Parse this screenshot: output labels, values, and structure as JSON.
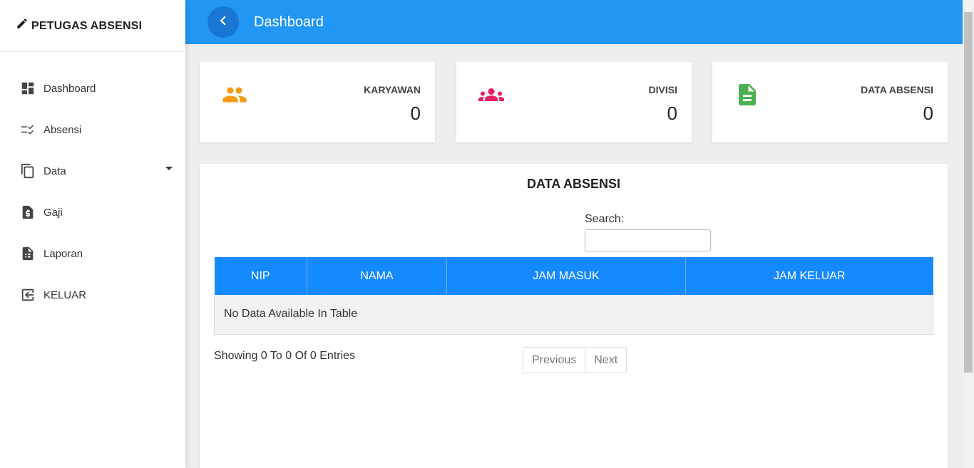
{
  "brand": {
    "title": "PETUGAS ABSENSI"
  },
  "sidebar": {
    "items": [
      {
        "label": "Dashboard"
      },
      {
        "label": "Absensi"
      },
      {
        "label": "Data"
      },
      {
        "label": "Gaji"
      },
      {
        "label": "Laporan"
      },
      {
        "label": "KELUAR"
      }
    ]
  },
  "header": {
    "title": "Dashboard"
  },
  "cards": [
    {
      "label": "KARYAWAN",
      "value": "0",
      "icon": "people-icon",
      "color": "#f59a14"
    },
    {
      "label": "DIVISI",
      "value": "0",
      "icon": "groups-icon",
      "color": "#e91e63"
    },
    {
      "label": "DATA ABSENSI",
      "value": "0",
      "icon": "document-icon",
      "color": "#4caf50"
    }
  ],
  "panel": {
    "title": "DATA ABSENSI",
    "search_label": "Search:",
    "search_value": "",
    "table": {
      "columns": [
        "NIP",
        "NAMA",
        "JAM MASUK",
        "JAM KELUAR"
      ],
      "empty_message": "No Data Available In Table"
    },
    "showing": "Showing 0 To 0 Of 0 Entries",
    "pagination": {
      "previous": "Previous",
      "next": "Next"
    }
  },
  "colors": {
    "topbar": "#2196f3",
    "table_header": "#1589ff",
    "back_button": "#1976d2"
  }
}
